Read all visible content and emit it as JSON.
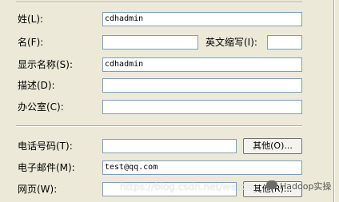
{
  "form": {
    "last_name": {
      "label": "姓(L):",
      "value": "cdhadmin"
    },
    "first_name": {
      "label": "名(F):",
      "value": ""
    },
    "initials": {
      "label": "英文缩写(I):",
      "value": ""
    },
    "display_name": {
      "label": "显示名称(S):",
      "value": "cdhadmin"
    },
    "description": {
      "label": "描述(D):",
      "value": ""
    },
    "office": {
      "label": "办公室(C):",
      "value": ""
    },
    "telephone": {
      "label": "电话号码(T):",
      "value": "",
      "other_button": "其他(O)..."
    },
    "email": {
      "label": "电子邮件(M):",
      "value": "test@qq.com"
    },
    "web_page": {
      "label": "网页(W):",
      "value": "",
      "other_button": "其他(R)..."
    }
  },
  "watermark": {
    "url": "https://blog.csdn.net/weixin_",
    "brand": "Hadoop实操"
  }
}
